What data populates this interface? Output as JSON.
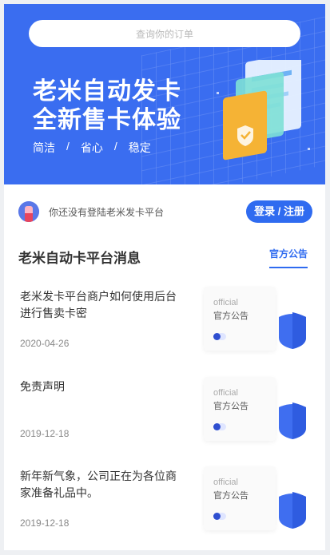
{
  "search": {
    "placeholder": "查询你的订单"
  },
  "hero": {
    "title_line1": "老米自动发卡",
    "title_line2": "全新售卡体验",
    "tags": [
      "简洁",
      "/",
      "省心",
      "/",
      "稳定"
    ]
  },
  "login": {
    "prompt": "你还没有登陆老米发卡平台",
    "button_label": "登录 / 注册"
  },
  "section": {
    "title": "老米自动卡平台消息",
    "tab_label": "官方公告"
  },
  "news": [
    {
      "title": "老米发卡平台商户如何使用后台进行售卖卡密",
      "date": "2020-04-26",
      "thumb_en": "official",
      "thumb_cn": "官方公告"
    },
    {
      "title": "免责声明",
      "date": "2019-12-18",
      "thumb_en": "official",
      "thumb_cn": "官方公告"
    },
    {
      "title": "新年新气象，公司正在为各位商家准备礼品中。",
      "date": "2019-12-18",
      "thumb_en": "official",
      "thumb_cn": "官方公告"
    }
  ],
  "colors": {
    "brand_blue": "#3a6df0",
    "button_blue": "#2f6bf0"
  }
}
